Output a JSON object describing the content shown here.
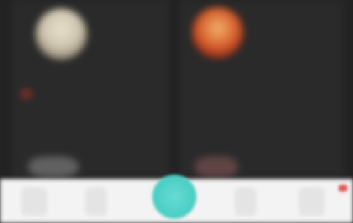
{
  "participants": [
    {
      "name": "",
      "avatar_icon": "participant-avatar",
      "status_icon": "flag-icon"
    },
    {
      "name": "",
      "avatar_icon": "participant-avatar"
    }
  ],
  "toolbar": {
    "items": [
      {
        "icon": "toolbar-icon"
      },
      {
        "icon": "toolbar-icon"
      },
      {
        "icon": "toolbar-icon"
      },
      {
        "icon": "toolbar-icon"
      }
    ],
    "primary_action_icon": "fab-icon"
  },
  "colors": {
    "background": "#232323",
    "tile": "#2a2a2a",
    "toolbar": "#f3f3f3",
    "accent": "#4ccfc6",
    "alert": "#e05757"
  }
}
